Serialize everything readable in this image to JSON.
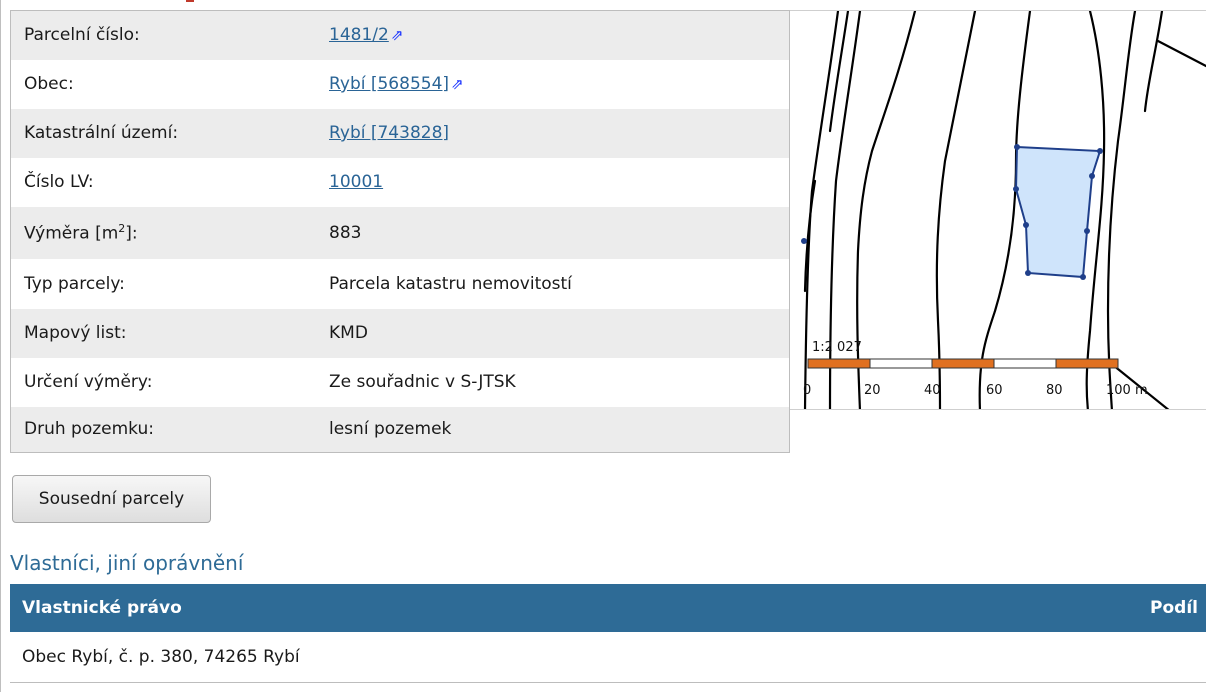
{
  "parcel": {
    "rows": [
      {
        "label": "Parcelní číslo:",
        "value": "1481/2",
        "link": true,
        "external": true
      },
      {
        "label": "Obec:",
        "value": "Rybí [568554]",
        "link": true,
        "external": true
      },
      {
        "label": "Katastrální území:",
        "value": "Rybí [743828]",
        "link": true,
        "external": false
      },
      {
        "label": "Číslo LV:",
        "value": "10001",
        "link": true,
        "external": false
      },
      {
        "label_prefix": "Výměra [m",
        "label_sup": "2",
        "label_suffix": "]:",
        "value": "883",
        "link": false
      },
      {
        "label": "Typ parcely:",
        "value": "Parcela katastru nemovitostí",
        "link": false
      },
      {
        "label": "Mapový list:",
        "value": "KMD",
        "link": false
      },
      {
        "label": "Určení výměry:",
        "value": "Ze souřadnic v S-JTSK",
        "link": false
      },
      {
        "label": "Druh pozemku:",
        "value": "lesní pozemek",
        "link": false
      }
    ]
  },
  "map": {
    "scale_text": "1:2 027",
    "scale_ticks": [
      "0",
      "20",
      "40",
      "60",
      "80",
      "100 m"
    ],
    "parcel_fill": "#cfe4fb",
    "parcel_stroke": "#1f3f8a",
    "scale_orange": "#e07020"
  },
  "buttons": {
    "neighbors": "Sousední parcely"
  },
  "owners": {
    "section_title": "Vlastníci, jiní oprávnění",
    "header_right": "Vlastnické právo",
    "header_share": "Podíl",
    "rows": [
      {
        "name": "Obec Rybí, č. p. 380, 74265 Rybí",
        "share": ""
      }
    ]
  },
  "colors": {
    "link": "#2a6496",
    "header_bg": "#2e6b96",
    "section_title": "#2e6b96"
  }
}
